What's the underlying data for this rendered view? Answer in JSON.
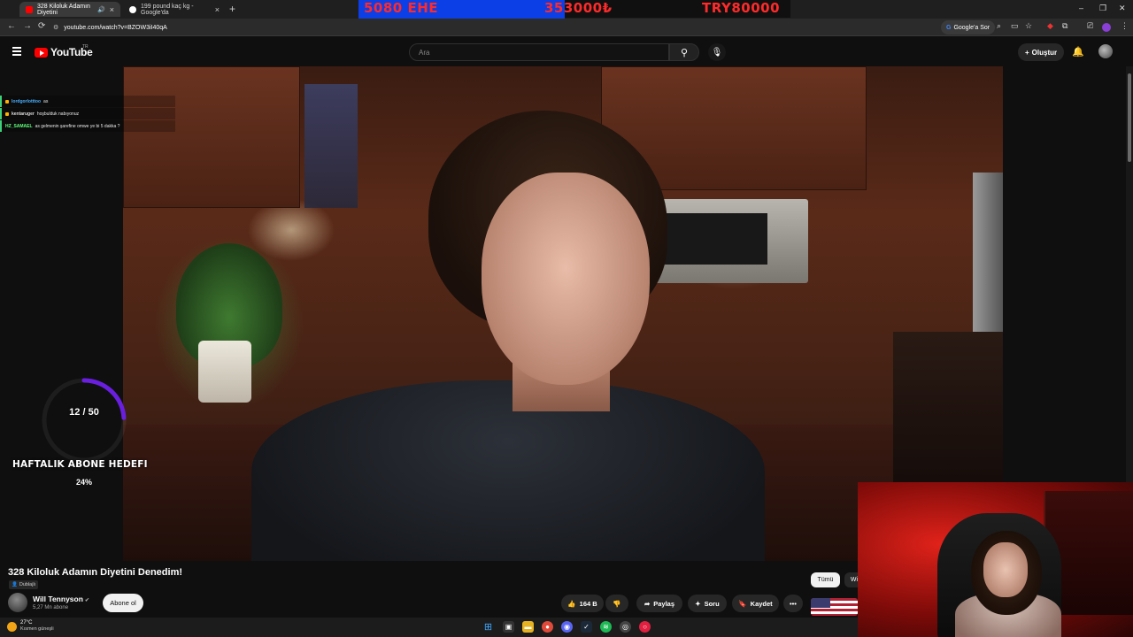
{
  "browser": {
    "tabs": [
      {
        "title": "328 Kiloluk Adamın Diyetini",
        "active": true
      },
      {
        "title": "199 pound kaç kg - Google'da",
        "active": false
      }
    ],
    "new_tab": "+",
    "url": "youtube.com/watch?v=BZOW3iI40qA",
    "google_sor": "Google'a Sor"
  },
  "stream_overlay": {
    "left_text": "5080 EHE",
    "mid_text": "353000₺",
    "right_text": "TRY80000"
  },
  "youtube": {
    "logo_text": "YouTube",
    "country": "TR",
    "search_placeholder": "Ara",
    "create_label": "Oluştur",
    "icons": {
      "search": "search-icon",
      "mic": "mic-icon",
      "bell": "bell-icon",
      "menu": "hamburger-icon"
    }
  },
  "chat": [
    {
      "user": "lordgorlotttoo",
      "message": "as"
    },
    {
      "user": "kentaruger",
      "message": "hoşbulduk nabıyonuz"
    },
    {
      "user": "HZ_SAMAEL",
      "message": "as gelmenin şarefine omwe ye bi 5 dakka ?"
    }
  ],
  "goal": {
    "count": "12 / 50",
    "title": "HAFTALIK ABONE HEDEFI",
    "percent_label": "24%",
    "progress": 0.24
  },
  "video": {
    "title": "328 Kiloluk Adamın Diyetini Denedim!",
    "dubbed": "Dublajlı",
    "channel_name": "Will Tennyson",
    "channel_subs": "5,27 Mn abone",
    "subscribe": "Abone ol",
    "likes": "164 B",
    "share": "Paylaş",
    "ask": "Soru",
    "save": "Kaydet",
    "more": "•••"
  },
  "related": {
    "chip_all": "Tümü",
    "chip_next": "Wi"
  },
  "taskbar": {
    "temperature": "27°C",
    "condition": "Kısmen güneşli"
  },
  "colors": {
    "yt_red": "#ff0000",
    "overlay_blue": "#0d3fe6",
    "overlay_red": "#ff2a2a",
    "goal_arc": "#6a1fe0"
  }
}
